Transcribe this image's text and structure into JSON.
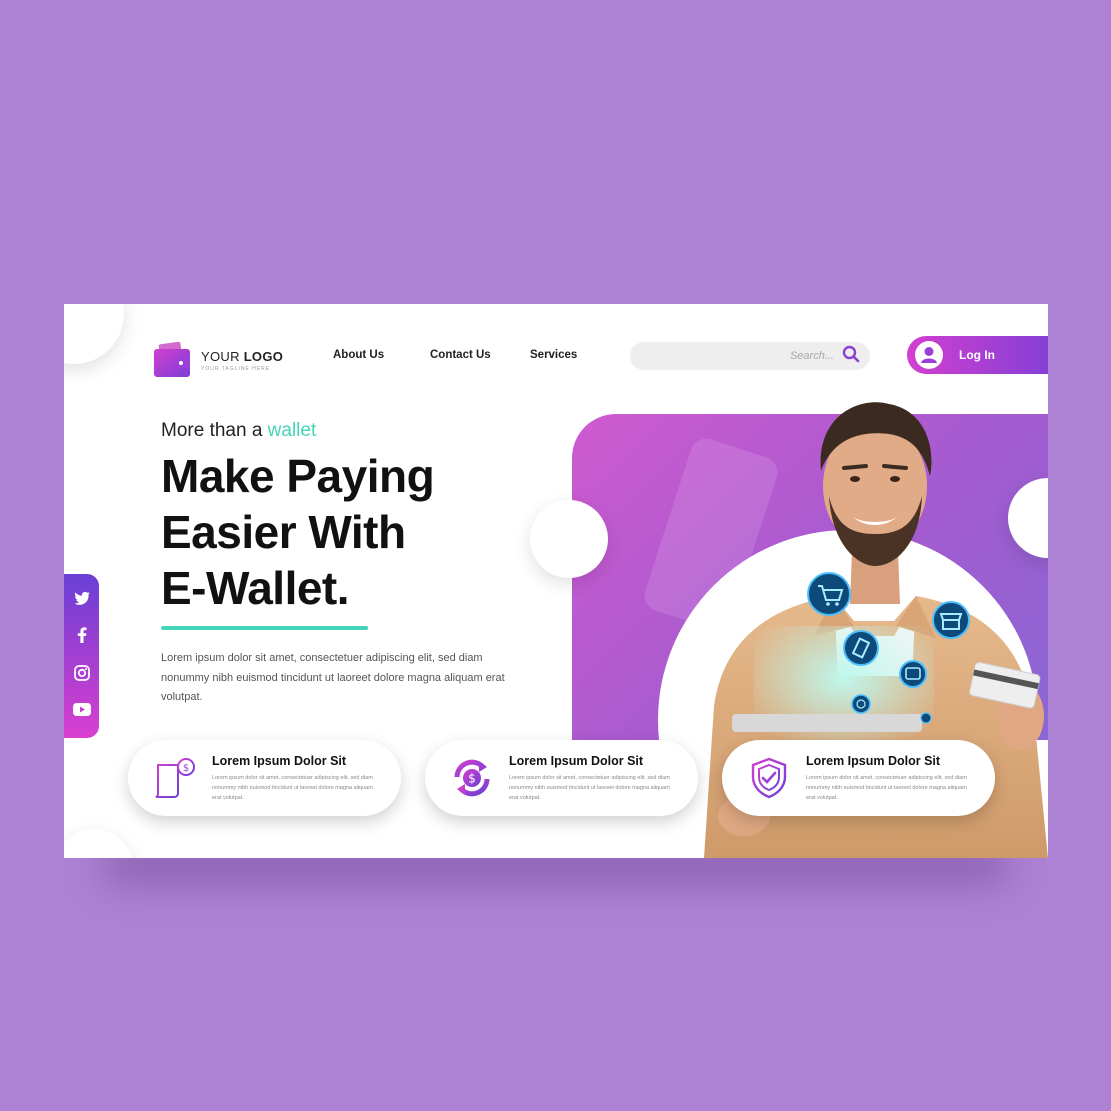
{
  "brand": {
    "logo_prefix": "YOUR",
    "logo_bold": "LOGO",
    "logo_tagline": "YOUR TAGLINE HERE",
    "accent_color": "#43d5b7",
    "gradient_start": "#d23fcf",
    "gradient_end": "#7b3fd6",
    "background_color": "#ad82d4"
  },
  "nav": {
    "items": [
      "About Us",
      "Contact Us",
      "Services"
    ]
  },
  "search": {
    "placeholder": "Search...",
    "icon": "search-icon"
  },
  "login": {
    "label": "Log In",
    "icon": "user-icon"
  },
  "hero": {
    "tagline_prefix": "More than a ",
    "tagline_accent": "wallet",
    "headline": [
      "Make Paying",
      "Easier With",
      "E-Wallet."
    ],
    "body": "Lorem ipsum dolor sit amet, consectetuer adipiscing elit, sed diam nonummy nibh euismod tincidunt ut laoreet dolore magna aliquam erat volutpat."
  },
  "social": {
    "icons": [
      "twitter-icon",
      "facebook-icon",
      "instagram-icon",
      "youtube-icon"
    ]
  },
  "features": [
    {
      "title": "Lorem Ipsum Dolor Sit",
      "body": "Lorem ipsum dolor sit amet, consectetuer adipiscing elit, sed diam nonummy nibh euismod tincidunt ut laoreet dolore magna aliquam erat volutpat.",
      "icon": "invoice-icon"
    },
    {
      "title": "Lorem Ipsum Dolor Sit",
      "body": "Lorem ipsum dolor sit amet, consectetuer adipiscing elit, sed diam nonummy nibh euismod tincidunt ut laoreet dolore magna aliquam erat volutpat.",
      "icon": "money-exchange-icon"
    },
    {
      "title": "Lorem Ipsum Dolor Sit",
      "body": "Lorem ipsum dolor sit amet, consectetuer adipiscing elit, sed diam nonummy nibh euismod tincidunt ut laoreet dolore magna aliquam erat volutpat.",
      "icon": "shield-check-icon"
    }
  ],
  "hero_image": {
    "floating_icons": [
      "cart-icon",
      "tag-icon",
      "store-icon",
      "wallet-icon",
      "globe-icon"
    ]
  }
}
